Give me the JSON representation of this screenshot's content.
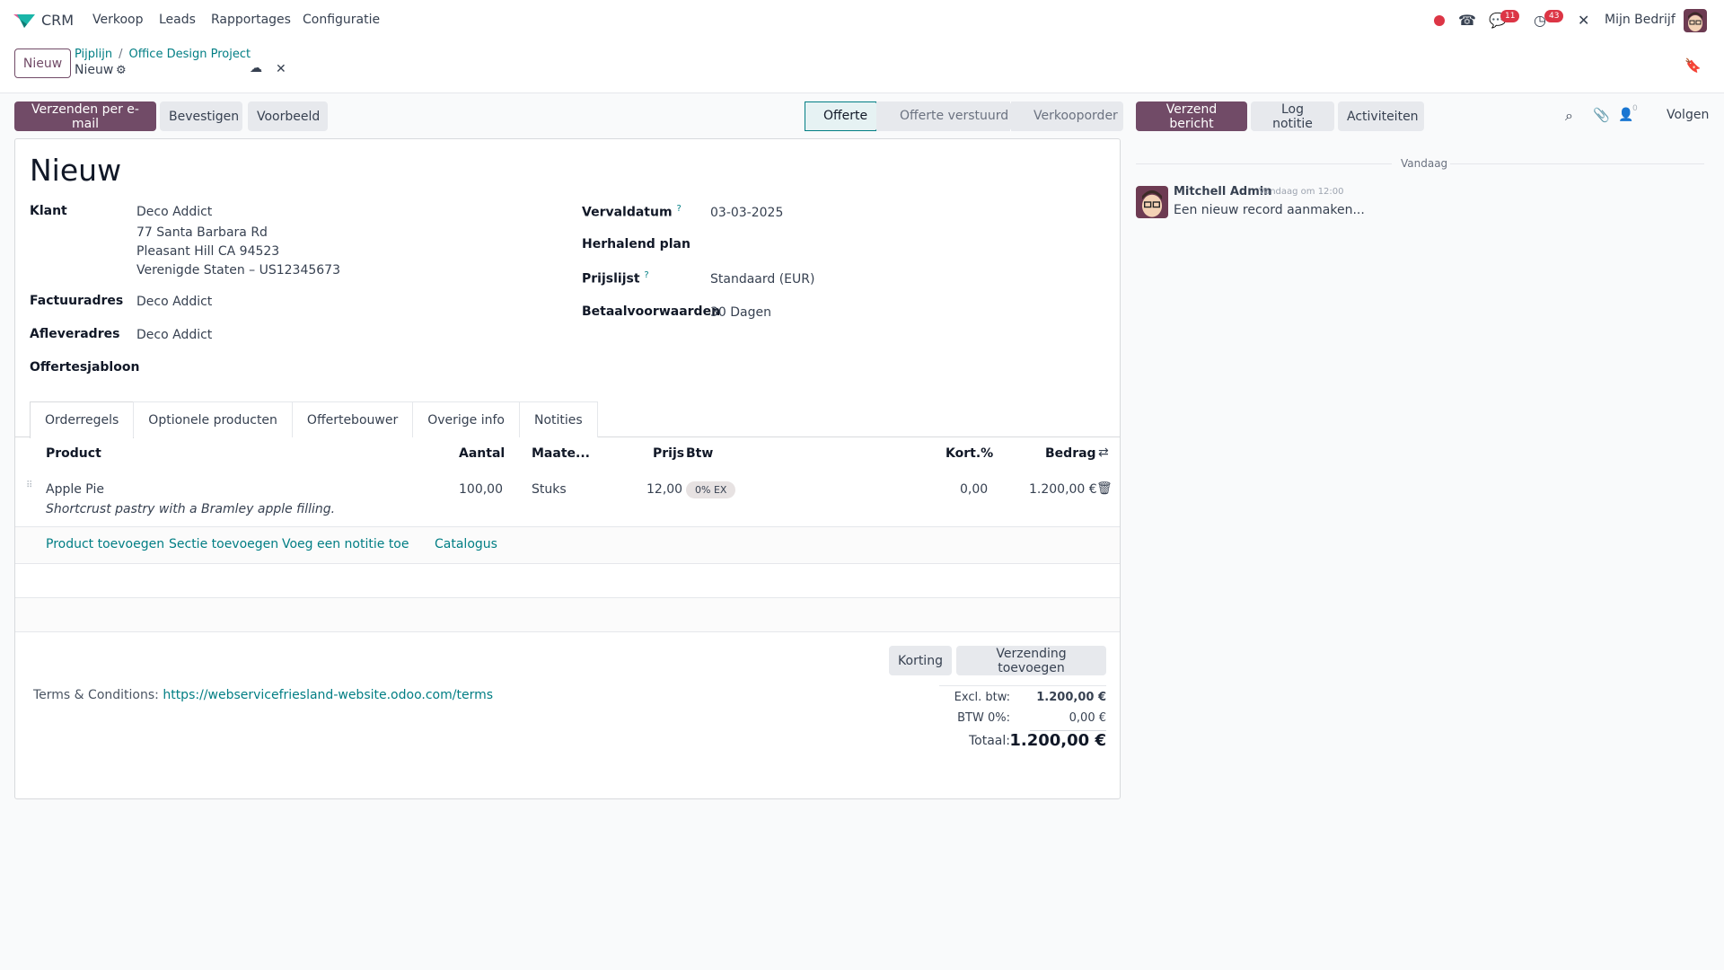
{
  "navbar": {
    "app_name": "CRM",
    "menus": [
      "Verkoop",
      "Leads",
      "Rapportages",
      "Configuratie"
    ],
    "messages_badge": "11",
    "activities_badge": "43",
    "company": "Mijn Bedrijf",
    "brand_color": "#714b67"
  },
  "control_panel": {
    "new_button": "Nieuw",
    "breadcrumb": [
      "Pijplijn",
      "Office Design Project"
    ],
    "record_name": "Nieuw"
  },
  "actions": {
    "send_email": "Verzenden per e-mail",
    "confirm": "Bevestigen",
    "preview": "Voorbeeld"
  },
  "statusbar": {
    "stages": [
      "Offerte",
      "Offerte verstuurd",
      "Verkooporder"
    ],
    "active": "Offerte"
  },
  "chatter": {
    "send_message": "Verzend bericht",
    "log_note": "Log notitie",
    "activities": "Activiteiten",
    "followers_count": "0",
    "follow": "Volgen",
    "day_separator": "Vandaag",
    "messages": [
      {
        "author": "Mitchell Admin",
        "time": "Vandaag om 12:00",
        "body": "Een nieuw record aanmaken..."
      }
    ]
  },
  "form": {
    "title": "Nieuw",
    "left_fields": {
      "customer_label": "Klant",
      "customer_name": "Deco Addict",
      "customer_address": [
        "77 Santa Barbara Rd",
        "Pleasant Hill CA 94523",
        "Verenigde Staten – US12345673"
      ],
      "invoice_label": "Factuuradres",
      "invoice_value": "Deco Addict",
      "delivery_label": "Afleveradres",
      "delivery_value": "Deco Addict",
      "template_label": "Offertesjabloon",
      "template_value": ""
    },
    "right_fields": {
      "expiry_label": "Vervaldatum",
      "expiry_value": "03-03-2025",
      "recurring_label": "Herhalend plan",
      "recurring_value": "",
      "pricelist_label": "Prijslijst",
      "pricelist_value": "Standaard (EUR)",
      "terms_label": "Betaalvoorwaarden",
      "terms_value": "30 Dagen"
    },
    "tabs": [
      "Orderregels",
      "Optionele producten",
      "Offertebouwer",
      "Overige info",
      "Notities"
    ],
    "active_tab": "Orderregels",
    "columns": [
      "Product",
      "Aantal",
      "Maate...",
      "Prijs",
      "Btw",
      "Kort.%",
      "Bedrag"
    ],
    "lines": [
      {
        "product": "Apple Pie",
        "description": "Shortcrust pastry with a Bramley apple filling.",
        "quantity": "100,00",
        "uom": "Stuks",
        "price": "12,00",
        "tax": "0% EX",
        "discount": "0,00",
        "amount": "1.200,00 €"
      }
    ],
    "add_links": [
      "Product toevoegen",
      "Sectie toevoegen",
      "Voeg een notitie toe",
      "Catalogus"
    ],
    "discount_button": "Korting",
    "shipping_button": "Verzending toevoegen",
    "terms_prefix": "Terms & Conditions:",
    "terms_link": "https://webservicefriesland-website.odoo.com/terms",
    "totals": {
      "untaxed_label": "Excl. btw:",
      "untaxed_value": "1.200,00 €",
      "tax_label": "BTW 0%:",
      "tax_value": "0,00 €",
      "total_label": "Totaal:",
      "total_value": "1.200,00 €"
    }
  }
}
